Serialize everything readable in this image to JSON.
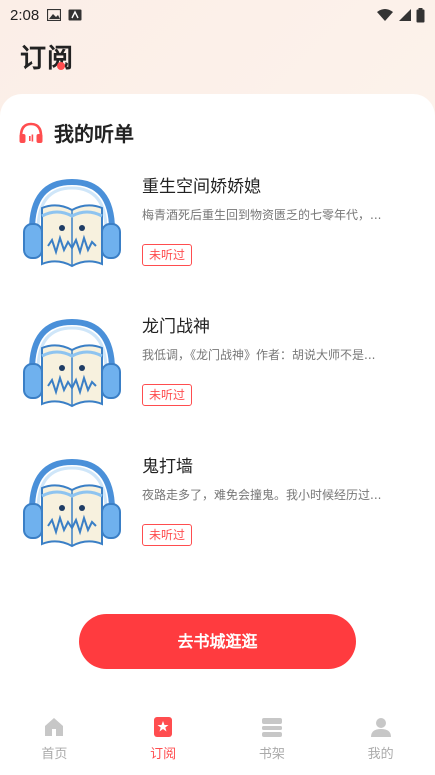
{
  "status_bar": {
    "time": "2:08"
  },
  "header": {
    "title_part1": "订",
    "title_part2": "阅"
  },
  "section": {
    "title": "我的听单"
  },
  "books": [
    {
      "title": "重生空间娇娇媳",
      "desc": "梅青酒死后重生回到物资匮乏的七零年代，...",
      "tag": "未听过"
    },
    {
      "title": "龙门战神",
      "desc": "我低调，《龙门战神》作者：胡说大师不是...",
      "tag": "未听过"
    },
    {
      "title": "鬼打墙",
      "desc": "夜路走多了，难免会撞鬼。我小时候经历过...",
      "tag": "未听过"
    }
  ],
  "cta": {
    "label": "去书城逛逛"
  },
  "nav": {
    "items": [
      {
        "label": "首页",
        "icon": "home-icon"
      },
      {
        "label": "订阅",
        "icon": "subscribe-icon",
        "active": true
      },
      {
        "label": "书架",
        "icon": "bookshelf-icon"
      },
      {
        "label": "我的",
        "icon": "profile-icon"
      }
    ]
  },
  "colors": {
    "accent": "#ff4d4f",
    "cta": "#ff3b3f",
    "inactive": "#aaaaaa"
  }
}
